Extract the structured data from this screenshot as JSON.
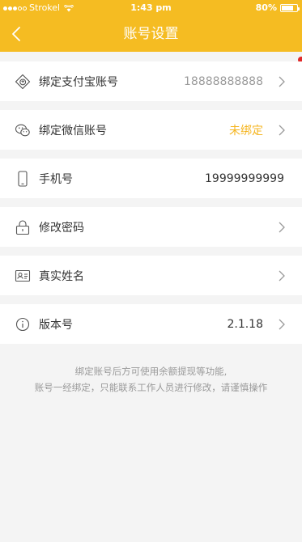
{
  "status_bar": {
    "carrier": "Strokel",
    "time": "1:43 pm",
    "battery": "80%",
    "battery_level": 0.8
  },
  "navbar": {
    "title": "账号设置",
    "back_icon": "chevron-left-icon"
  },
  "rows": [
    {
      "label": "绑定支付宝账号",
      "value": "18888888888",
      "icon": "alipay-icon",
      "chevron": true
    },
    {
      "label": "绑定微信账号",
      "value": "未绑定",
      "icon": "wechat-icon",
      "chevron": true
    },
    {
      "label": "手机号",
      "value": "19999999999",
      "icon": "phone-icon",
      "chevron": false
    },
    {
      "label": "修改密码",
      "value": "",
      "icon": "lock-icon",
      "chevron": true
    },
    {
      "label": "真实姓名",
      "value": "",
      "icon": "id-card-icon",
      "chevron": true
    },
    {
      "label": "版本号",
      "value": "2.1.18",
      "icon": "info-icon",
      "chevron": true
    }
  ],
  "footnote": {
    "line1": "绑定账号后方可使用余额提现等功能,",
    "line2": "账号一经绑定，只能联系工作人员进行修改，请谨慎操作"
  },
  "colors": {
    "accent": "#f5bc22",
    "highlight_value": "#f5b520",
    "background": "#f4f4f4"
  }
}
